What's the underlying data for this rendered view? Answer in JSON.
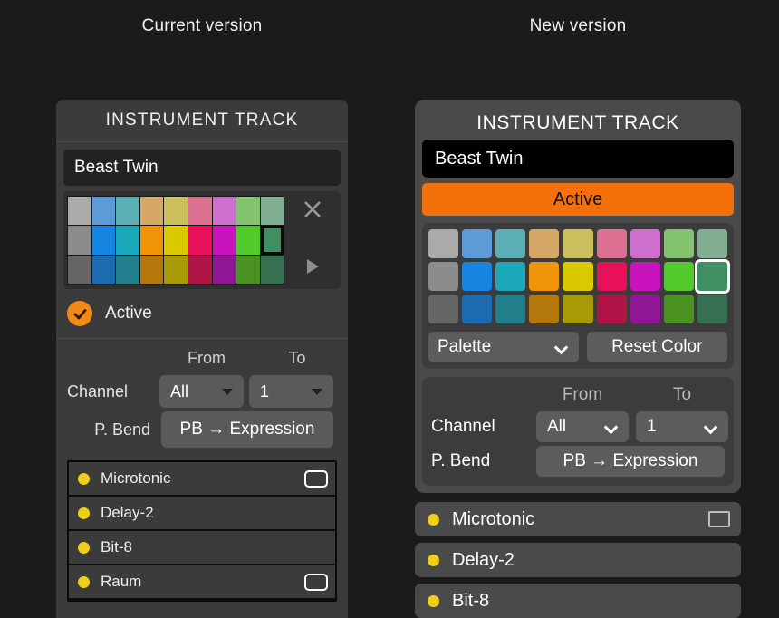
{
  "headers": {
    "left": "Current version",
    "right": "New version"
  },
  "colors": {
    "accent_orange": "#f4700a",
    "check_orange": "#f28a16",
    "dot_yellow": "#f0cf19",
    "panel_bg": "#3b3b3b",
    "card_bg": "#4a4a4a",
    "page_bg": "#1b1b1b"
  },
  "palette": {
    "rows": [
      [
        "#aaaaaa",
        "#5c9bd8",
        "#5aafb5",
        "#d6a868",
        "#cbbf5e",
        "#dd7192",
        "#ce6fcd",
        "#85c46f",
        "#81ae90"
      ],
      [
        "#8c8c8c",
        "#1684e0",
        "#1ca8bb",
        "#ef9307",
        "#dbc900",
        "#e8105a",
        "#c913bd",
        "#52cb2a",
        "#3f8f62"
      ],
      [
        "#666666",
        "#1c6aaf",
        "#21808b",
        "#b3770c",
        "#a69a06",
        "#b01446",
        "#8f1694",
        "#4a9322",
        "#376f52"
      ]
    ],
    "selected_row": 1,
    "selected_col": 8
  },
  "left_panel": {
    "title": "INSTRUMENT TRACK",
    "track_name": "Beast Twin",
    "close_icon": "close-icon",
    "expand_icon": "play-triangle-icon",
    "active_label": "Active",
    "active_checked": true,
    "routing": {
      "from_label": "From",
      "to_label": "To",
      "channel_label": "Channel",
      "channel_from": "All",
      "channel_to": "1",
      "pbend_label": "P. Bend",
      "pbend_button": "PB → Expression"
    },
    "plugins": [
      {
        "name": "Microtonic",
        "has_window_icon": true
      },
      {
        "name": "Delay-2",
        "has_window_icon": false
      },
      {
        "name": "Bit-8",
        "has_window_icon": false
      },
      {
        "name": "Raum",
        "has_window_icon": true
      }
    ]
  },
  "right_panel": {
    "title": "INSTRUMENT TRACK",
    "track_name": "Beast Twin",
    "active_button": "Active",
    "palette_select": "Palette",
    "reset_button": "Reset Color",
    "routing": {
      "from_label": "From",
      "to_label": "To",
      "channel_label": "Channel",
      "channel_from": "All",
      "channel_to": "1",
      "pbend_label": "P. Bend",
      "pbend_button": "PB → Expression"
    },
    "plugins": [
      {
        "name": "Microtonic",
        "has_window_icon": true
      },
      {
        "name": "Delay-2",
        "has_window_icon": false
      },
      {
        "name": "Bit-8",
        "has_window_icon": false
      }
    ]
  }
}
